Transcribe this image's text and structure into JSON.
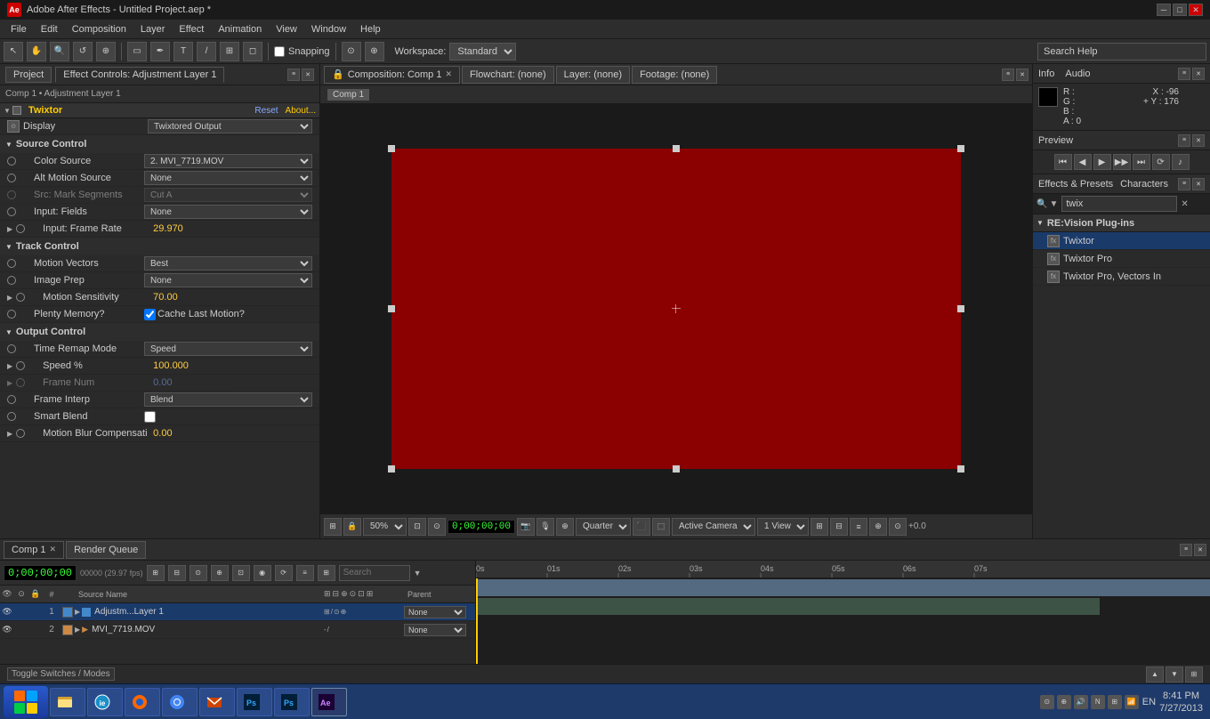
{
  "titleBar": {
    "icon": "Ae",
    "title": "Adobe After Effects - Untitled Project.aep *",
    "minimize": "─",
    "maximize": "□",
    "close": "✕"
  },
  "menuBar": {
    "items": [
      "File",
      "Edit",
      "Composition",
      "Layer",
      "Effect",
      "Animation",
      "View",
      "Window",
      "Help"
    ]
  },
  "toolbar": {
    "snapping_label": "Snapping",
    "workspace_label": "Workspace:",
    "workspace_value": "Standard",
    "search_placeholder": "Search Help"
  },
  "leftPanel": {
    "tab_project": "Project",
    "tab_effect_controls": "Effect Controls: Adjustment Layer 1",
    "breadcrumb": "Comp 1 • Adjustment Layer 1",
    "effect": {
      "name": "Twixtor",
      "reset": "Reset",
      "about": "About...",
      "display_value": "Twixtored Output",
      "groups": [
        {
          "name": "Source Control",
          "properties": [
            {
              "name": "Color Source",
              "type": "dropdown",
              "value": "2. MVI_7719.MOV",
              "indented": 1
            },
            {
              "name": "Alt Motion Source",
              "type": "dropdown",
              "value": "None",
              "indented": 1
            },
            {
              "name": "Src: Mark Segments",
              "type": "dropdown",
              "value": "Cut A",
              "indented": 1,
              "disabled": true
            },
            {
              "name": "Input: Fields",
              "type": "dropdown",
              "value": "None",
              "indented": 1
            },
            {
              "name": "Input: Frame Rate",
              "type": "value",
              "value": "29.970",
              "indented": 1,
              "sub": true
            }
          ]
        },
        {
          "name": "Track Control",
          "properties": [
            {
              "name": "Motion Vectors",
              "type": "dropdown",
              "value": "Best",
              "indented": 1
            },
            {
              "name": "Image Prep",
              "type": "dropdown",
              "value": "None",
              "indented": 1
            },
            {
              "name": "Motion Sensitivity",
              "type": "value",
              "value": "70.00",
              "indented": 1,
              "sub": true
            },
            {
              "name": "Plenty Memory?",
              "type": "checkbox",
              "value": true,
              "label": "Cache Last Motion?",
              "indented": 1
            }
          ]
        },
        {
          "name": "Output Control",
          "properties": [
            {
              "name": "Time Remap Mode",
              "type": "dropdown",
              "value": "Speed",
              "indented": 1
            },
            {
              "name": "Speed %",
              "type": "value",
              "value": "100.000",
              "indented": 1,
              "sub": true
            },
            {
              "name": "Frame Num",
              "type": "value",
              "value": "0.00",
              "indented": 1,
              "sub": true,
              "disabled": true
            },
            {
              "name": "Frame Interp",
              "type": "dropdown",
              "value": "Blend",
              "indented": 1
            },
            {
              "name": "Smart Blend",
              "type": "checkbox_only",
              "value": false,
              "indented": 1
            },
            {
              "name": "Motion Blur Compensati",
              "type": "value",
              "value": "0.00",
              "indented": 1,
              "sub": true
            }
          ]
        }
      ]
    }
  },
  "viewer": {
    "tabs": [
      {
        "label": "Composition: Comp 1",
        "active": true,
        "closable": true
      },
      {
        "label": "Flowchart: (none)",
        "active": false
      },
      {
        "label": "Layer: (none)",
        "active": false
      },
      {
        "label": "Footage: (none)",
        "active": false
      }
    ],
    "comp_label": "Comp 1",
    "zoom": "50%",
    "timecode": "0;00;00;00",
    "quality": "Quarter",
    "view": "Active Camera",
    "view_num": "1 View",
    "offset": "+0.0"
  },
  "rightPanel": {
    "info": {
      "title": "Info",
      "tab_info": "Info",
      "tab_audio": "Audio",
      "r": "R :",
      "g": "G :",
      "b": "B :",
      "a": "A : 0",
      "x": "X : -96",
      "y": "+ Y : 176"
    },
    "preview": {
      "title": "Preview"
    },
    "effects": {
      "title": "Effects & Presets",
      "search_value": "twix",
      "group": "RE:Vision Plug-ins",
      "items": [
        "Twixtor",
        "Twixtor Pro",
        "Twixtor Pro, Vectors In"
      ]
    },
    "characters": {
      "title": "Characters"
    }
  },
  "timeline": {
    "tabs": [
      "Comp 1",
      "Render Queue"
    ],
    "timecode": "0;00;00;00",
    "fps": "00000 (29.97 fps)",
    "toggle_label": "Toggle Switches / Modes",
    "layers": [
      {
        "num": 1,
        "color": "#4488cc",
        "name": "Adjustm...Layer 1",
        "type": "adjustment"
      },
      {
        "num": 2,
        "color": "#cc8844",
        "name": "MVI_7719.MOV",
        "type": "video"
      }
    ],
    "rulers": [
      "0s",
      "01s",
      "02s",
      "03s",
      "04s",
      "05s",
      "06s",
      "07s"
    ],
    "parent_options": [
      "None"
    ]
  },
  "statusBar": {
    "toggle_btn": "Toggle Switches / Modes"
  },
  "taskbar": {
    "time": "8:41 PM",
    "date": "7/27/2013",
    "lang": "EN"
  }
}
